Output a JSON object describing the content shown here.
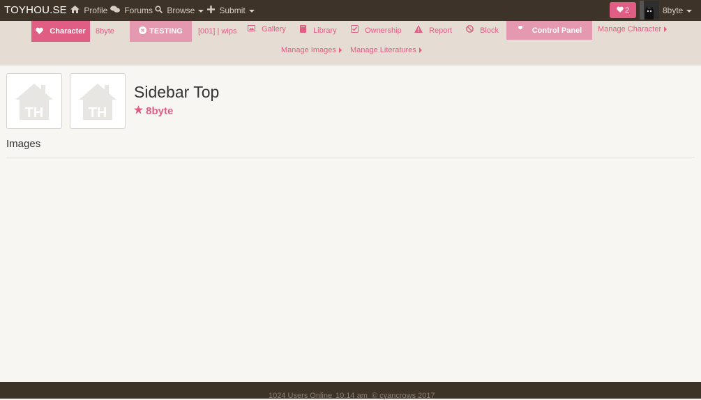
{
  "nav": {
    "brand": "TOYHOU.SE",
    "profile": "Profile",
    "forums": "Forums",
    "browse": "Browse",
    "submit": "Submit",
    "favorites_count": "2",
    "username": "8byte"
  },
  "character_bar": {
    "character_label": "Character",
    "owner": "8byte",
    "testing_label": "TESTING",
    "wips_label": "[001] | wips",
    "gallery": "Gallery",
    "library": "Library",
    "ownership": "Ownership",
    "report": "Report",
    "block": "Block",
    "control_panel": "Control Panel",
    "manage_character": "Manage Character",
    "manage_images": "Manage Images",
    "manage_literatures": "Manage Literatures"
  },
  "main": {
    "thumb_logo": "TH",
    "title": "Sidebar Top",
    "owner": "8byte",
    "section_heading": "Images"
  },
  "footer": {
    "users_online": "1024 Users Online",
    "time": "10:14 am",
    "copyright": "© cyancrows 2017"
  },
  "colors": {
    "accent": "#e05d84",
    "accent_light": "#e599b0",
    "navbar": "#3e3328",
    "subbar": "#e5ddd3",
    "page": "#f8f6f3"
  }
}
